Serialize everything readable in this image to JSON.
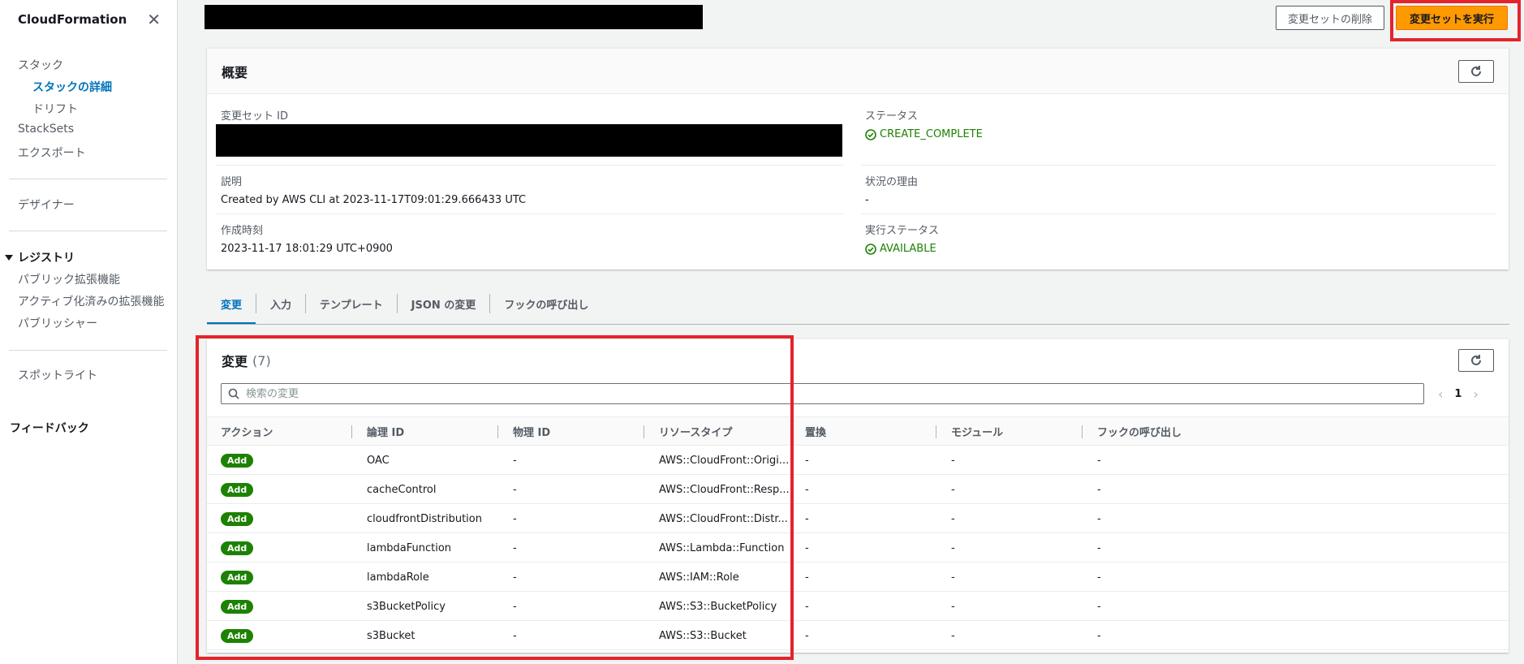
{
  "sidebar": {
    "title": "CloudFormation",
    "items": {
      "stacks": "スタック",
      "stack_details": "スタックの詳細",
      "drift": "ドリフト",
      "stacksets": "StackSets",
      "exports": "エクスポート",
      "designer": "デザイナー",
      "registry": "レジストリ",
      "public_extensions": "パブリック拡張機能",
      "activated_extensions": "アクティブ化済みの拡張機能",
      "publishers": "パブリッシャー",
      "spotlight": "スポットライト",
      "feedback": "フィードバック"
    }
  },
  "header": {
    "delete_label": "変更セットの削除",
    "execute_label": "変更セットを実行"
  },
  "overview": {
    "title": "概要",
    "changeset_id_label": "変更セット ID",
    "status_label": "ステータス",
    "status_value": "CREATE_COMPLETE",
    "description_label": "説明",
    "description_value": "Created by AWS CLI at 2023-11-17T09:01:29.666433 UTC",
    "reason_label": "状況の理由",
    "reason_value": "-",
    "created_label": "作成時刻",
    "created_value": "2023-11-17 18:01:29 UTC+0900",
    "exec_status_label": "実行ステータス",
    "exec_status_value": "AVAILABLE"
  },
  "tabs": [
    "変更",
    "入力",
    "テンプレート",
    "JSON の変更",
    "フックの呼び出し"
  ],
  "changes": {
    "title": "変更",
    "count": "(7)",
    "search_placeholder": "検索の変更",
    "page": "1",
    "columns": [
      "アクション",
      "論理 ID",
      "物理 ID",
      "リソースタイプ",
      "置換",
      "モジュール",
      "フックの呼び出し"
    ],
    "rows": [
      {
        "action": "Add",
        "logical_id": "OAC",
        "physical_id": "-",
        "resource_type": "AWS::CloudFront::Origi...",
        "replacement": "-",
        "module": "-",
        "hooks": "-"
      },
      {
        "action": "Add",
        "logical_id": "cacheControl",
        "physical_id": "-",
        "resource_type": "AWS::CloudFront::Resp...",
        "replacement": "-",
        "module": "-",
        "hooks": "-"
      },
      {
        "action": "Add",
        "logical_id": "cloudfrontDistribution",
        "physical_id": "-",
        "resource_type": "AWS::CloudFront::Distr...",
        "replacement": "-",
        "module": "-",
        "hooks": "-"
      },
      {
        "action": "Add",
        "logical_id": "lambdaFunction",
        "physical_id": "-",
        "resource_type": "AWS::Lambda::Function",
        "replacement": "-",
        "module": "-",
        "hooks": "-"
      },
      {
        "action": "Add",
        "logical_id": "lambdaRole",
        "physical_id": "-",
        "resource_type": "AWS::IAM::Role",
        "replacement": "-",
        "module": "-",
        "hooks": "-"
      },
      {
        "action": "Add",
        "logical_id": "s3BucketPolicy",
        "physical_id": "-",
        "resource_type": "AWS::S3::BucketPolicy",
        "replacement": "-",
        "module": "-",
        "hooks": "-"
      },
      {
        "action": "Add",
        "logical_id": "s3Bucket",
        "physical_id": "-",
        "resource_type": "AWS::S3::Bucket",
        "replacement": "-",
        "module": "-",
        "hooks": "-"
      }
    ]
  },
  "colors": {
    "accent": "#0073bb",
    "primary_button": "#ff9900",
    "success": "#1d8102",
    "highlight": "#e3242b"
  }
}
